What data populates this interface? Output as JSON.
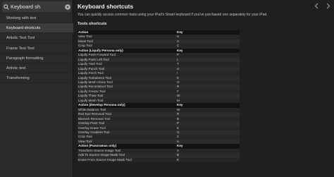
{
  "search": {
    "value": "Keyboard sh",
    "placeholder": "Search"
  },
  "sidebar": {
    "items": [
      {
        "label": "Working with text",
        "active": false
      },
      {
        "label": "Keyboard shortcuts",
        "active": true
      },
      {
        "label": "Artistic Text Tool",
        "active": false
      },
      {
        "label": "Frame Text Tool",
        "active": false
      },
      {
        "label": "Paragraph formatting",
        "active": false
      },
      {
        "label": "Artistic text",
        "active": false
      },
      {
        "label": "Transforming",
        "active": false
      }
    ]
  },
  "content": {
    "title": "Keyboard shortcuts",
    "intro": "You can quickly access common tools using your iPad's Smart keyboard if you've purchased one separately for your iPad.",
    "section_title": "Tools shortcuts",
    "rows": [
      {
        "action": "Action",
        "key": "Key",
        "head": true
      },
      {
        "action": "View Tool",
        "key": "H"
      },
      {
        "action": "Move Tool",
        "key": "V"
      },
      {
        "action": "Crop Tool",
        "key": "C"
      },
      {
        "action": "Action (Liquify Persona only)",
        "key": "Key",
        "head": true
      },
      {
        "action": "Liquify Push Forward Tool",
        "key": "P"
      },
      {
        "action": "Liquify Push Left Tool",
        "key": "L"
      },
      {
        "action": "Liquify Twirl Tool",
        "key": "T"
      },
      {
        "action": "Liquify Punch Tool",
        "key": "U"
      },
      {
        "action": "Liquify Pinch Tool",
        "key": "I"
      },
      {
        "action": "Liquify Turbulence Tool",
        "key": "K"
      },
      {
        "action": "Liquify Mesh Clone Tool",
        "key": "O"
      },
      {
        "action": "Liquify Reconstruct Tool",
        "key": "R"
      },
      {
        "action": "Liquify Freeze Tool",
        "key": "F"
      },
      {
        "action": "Liquify Thaw Tool",
        "key": "W"
      },
      {
        "action": "Liquify Mesh Tool",
        "key": "M"
      },
      {
        "action": "Action (Develop Persona only)",
        "key": "Key",
        "head": true
      },
      {
        "action": "White Balance Tool",
        "key": "W"
      },
      {
        "action": "Red Eye Removal Tool",
        "key": "R"
      },
      {
        "action": "Blemish Removal Tool",
        "key": "B"
      },
      {
        "action": "Overlay Paint Tool",
        "key": "P"
      },
      {
        "action": "Overlay Erase Tool",
        "key": "E"
      },
      {
        "action": "Overlay Gradient Tool",
        "key": "G"
      },
      {
        "action": "Crop Tool",
        "key": "C"
      },
      {
        "action": "View Tool",
        "key": "H"
      },
      {
        "action": "Action (Panoramas only)",
        "key": "Key",
        "head": true
      },
      {
        "action": "Transform Source Image Tool",
        "key": "V"
      },
      {
        "action": "Add To Source Image Mask Tool",
        "key": "B"
      },
      {
        "action": "Erase From Source Image Mask Tool",
        "key": "E"
      }
    ]
  },
  "icons": {
    "search": "search-icon",
    "clear": "clear-circle-icon",
    "back": "chevron-left-icon",
    "forward": "chevron-right-icon"
  },
  "colors": {
    "sidebar_bg": "#2a2a2a",
    "active_item_bg": "#3c3c3c",
    "content_bg": "#1f1f1f",
    "table_head_bg": "#121212"
  }
}
